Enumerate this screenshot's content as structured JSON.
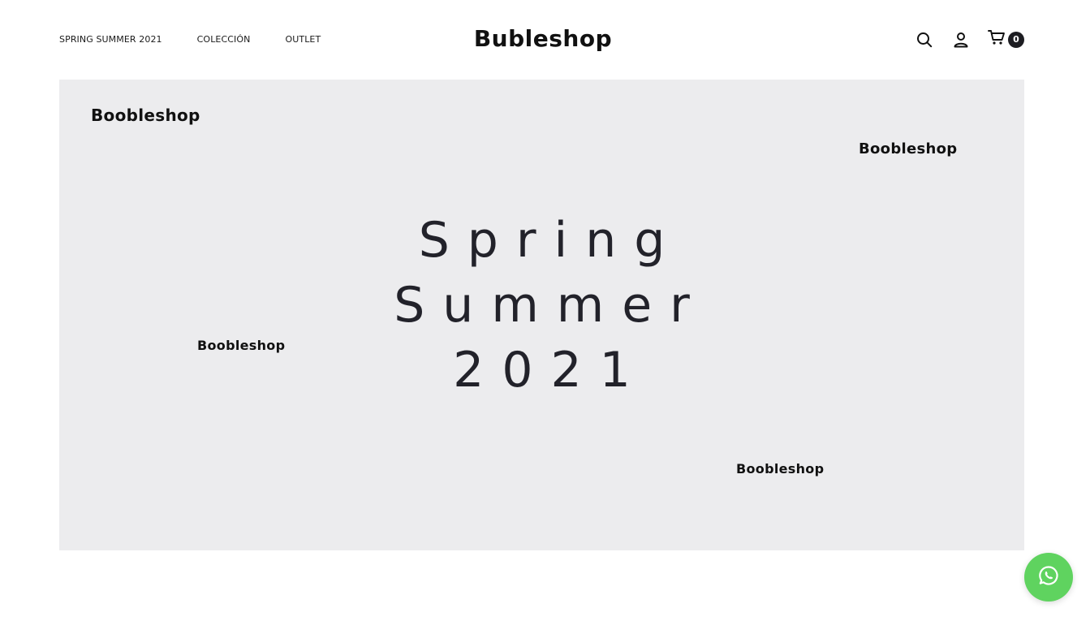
{
  "header": {
    "nav": [
      {
        "label": "SPRING SUMMER 2021"
      },
      {
        "label": "COLECCIÓN"
      },
      {
        "label": "OUTLET"
      }
    ],
    "brand": "Bubleshop",
    "cart_count": "0",
    "icons": {
      "search": "search-icon",
      "account": "user-icon",
      "cart": "cart-icon"
    }
  },
  "hero": {
    "logos": [
      "Boobleshop",
      "Boobleshop",
      "Boobleshop",
      "Boobleshop"
    ],
    "title_lines": [
      "Spring",
      "Summer",
      "2021"
    ],
    "background": "#ececee"
  },
  "floating": {
    "icon": "whatsapp-icon",
    "color": "#5fd35f"
  }
}
